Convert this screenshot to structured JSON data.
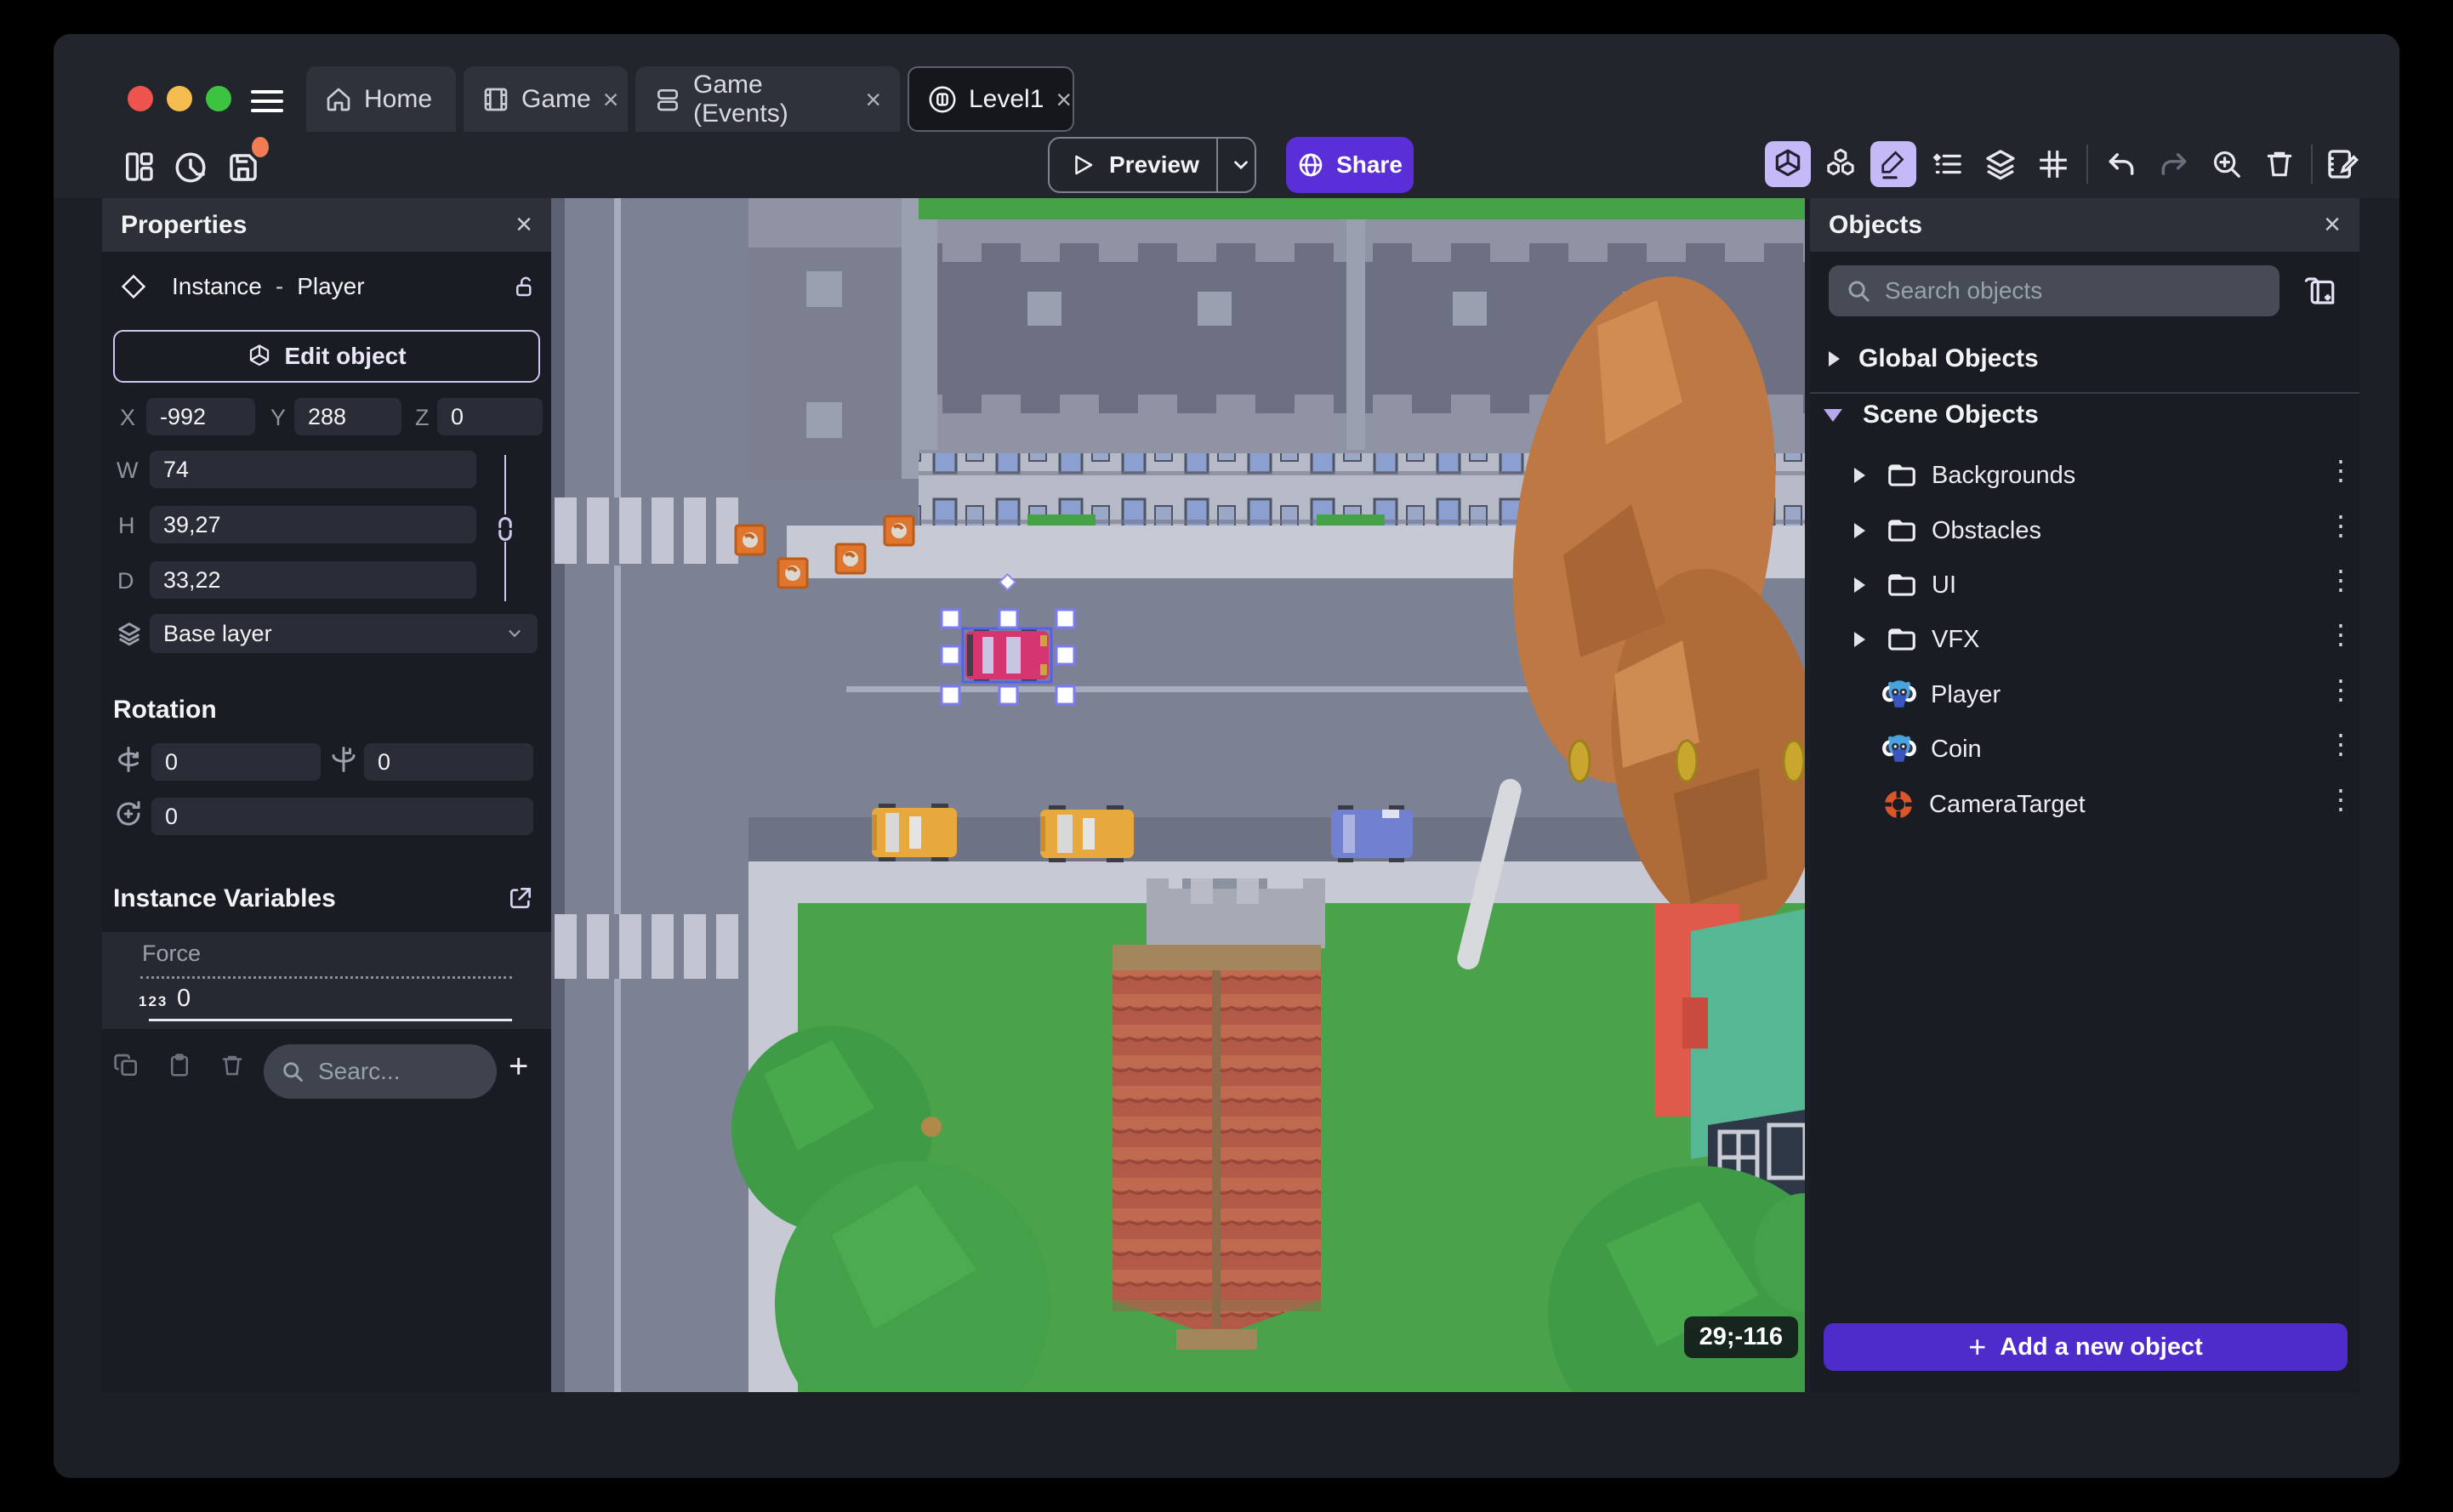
{
  "glyphs": {
    "close": "×",
    "kebab": "⋮",
    "plus": "+"
  },
  "titlebar": {
    "tabs": [
      {
        "label": "Home"
      },
      {
        "label": "Game"
      },
      {
        "label": "Game (Events)"
      },
      {
        "label": "Level1"
      }
    ]
  },
  "toolbar": {
    "preview": "Preview",
    "share": "Share"
  },
  "properties": {
    "title": "Properties",
    "instance_type": "Instance",
    "separator": "-",
    "instance_name": "Player",
    "edit_object_label": "Edit object",
    "position": {
      "x_label": "X",
      "x": "-992",
      "y_label": "Y",
      "y": "288",
      "z_label": "Z",
      "z": "0"
    },
    "size": {
      "w_label": "W",
      "w": "74",
      "h_label": "H",
      "h": "39,27",
      "d_label": "D",
      "d": "33,22"
    },
    "layer": "Base layer",
    "rotation_title": "Rotation",
    "rotation": {
      "rx": "0",
      "ry": "0",
      "rz": "0"
    },
    "instance_variables_title": "Instance Variables",
    "variable": {
      "name": "Force",
      "type_badge": "123",
      "value": "0"
    },
    "search_placeholder": "Searc..."
  },
  "objects": {
    "title": "Objects",
    "search_placeholder": "Search objects",
    "global_section": "Global Objects",
    "scene_section": "Scene Objects",
    "tree": [
      {
        "label": "Backgrounds"
      },
      {
        "label": "Obstacles"
      },
      {
        "label": "UI"
      },
      {
        "label": "VFX"
      },
      {
        "label": "Player"
      },
      {
        "label": "Coin"
      },
      {
        "label": "CameraTarget"
      }
    ],
    "add_button": "Add a new object"
  },
  "scene": {
    "coords": "29;-116"
  },
  "colors": {
    "accent": "#5a2fd8",
    "add_button": "#4e2ccb",
    "active_icon_bg": "#c6b9f8",
    "selection": "#5560ee",
    "unsaved_dot": "#f07c55"
  }
}
